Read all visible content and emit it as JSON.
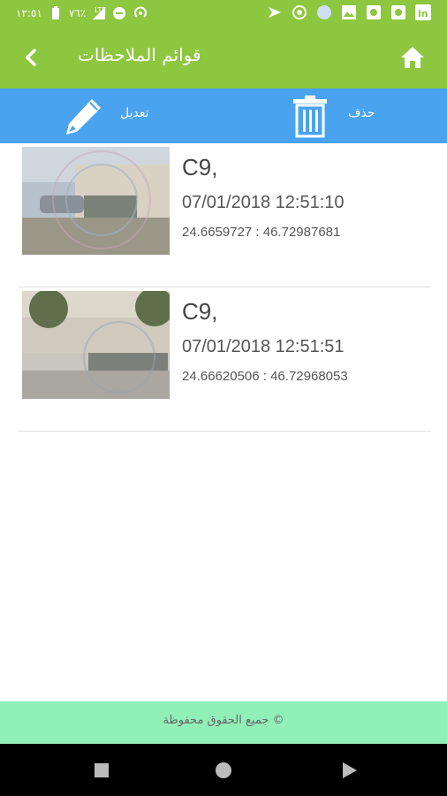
{
  "status_bar": {
    "time": "١٢:٥١",
    "battery": "٧٦٪",
    "network": "LTE",
    "left_icons": [
      "linkedin-icon",
      "camera-icon",
      "camera-icon",
      "image-icon",
      "circle-icon",
      "circle-dot-icon",
      "flag-icon"
    ],
    "right_icons": [
      "hotspot-icon",
      "dnd-icon",
      "signal-icon",
      "battery-icon"
    ]
  },
  "header": {
    "title": "قوائم الملاحظات",
    "back_icon": "chevron-left-icon",
    "home_icon": "home-icon"
  },
  "toolbar": {
    "edit_label": "تعديل",
    "delete_label": "حذف",
    "edit_icon": "pencil-icon",
    "delete_icon": "trash-icon"
  },
  "notes": [
    {
      "title": "C9,",
      "datetime": "07/01/2018 12:51:10",
      "coords": "24.6659727 : 46.72987681"
    },
    {
      "title": "C9,",
      "datetime": "07/01/2018 12:51:51",
      "coords": "24.66620506 : 46.72968053"
    }
  ],
  "footer": {
    "text": "© جميع الحقوق محفوظة"
  },
  "nav": {
    "icons": [
      "square-icon",
      "circle-icon",
      "triangle-icon"
    ]
  },
  "colors": {
    "green": "#8dc63f",
    "blue": "#4aa3ef",
    "footer": "#91f0b8"
  }
}
